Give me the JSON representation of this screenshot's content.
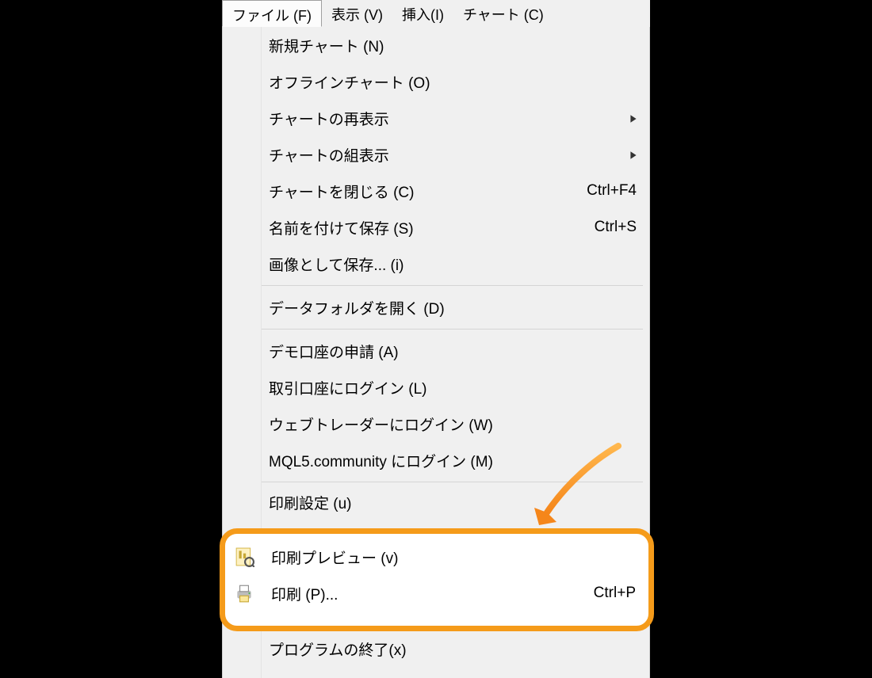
{
  "menubar": {
    "file": "ファイル (F)",
    "view": "表示 (V)",
    "insert": "挿入(I)",
    "chart": "チャート (C)"
  },
  "menu": {
    "new_chart": "新規チャート (N)",
    "offline_chart": "オフラインチャート (O)",
    "redisplay_chart": "チャートの再表示",
    "chart_group": "チャートの組表示",
    "close_chart": "チャートを閉じる (C)",
    "close_chart_acc": "Ctrl+F4",
    "save_as": "名前を付けて保存 (S)",
    "save_as_acc": "Ctrl+S",
    "save_image": "画像として保存... (i)",
    "open_data_folder": "データフォルダを開く (D)",
    "request_demo": "デモ口座の申請 (A)",
    "login_trade": "取引口座にログイン (L)",
    "login_web": "ウェブトレーダーにログイン (W)",
    "login_mql5": "MQL5.community にログイン (M)",
    "print_setup": "印刷設定 (u)",
    "print_preview": "印刷プレビュー (v)",
    "print": "印刷 (P)...",
    "print_acc": "Ctrl+P",
    "exit": "プログラムの終了(x)"
  }
}
